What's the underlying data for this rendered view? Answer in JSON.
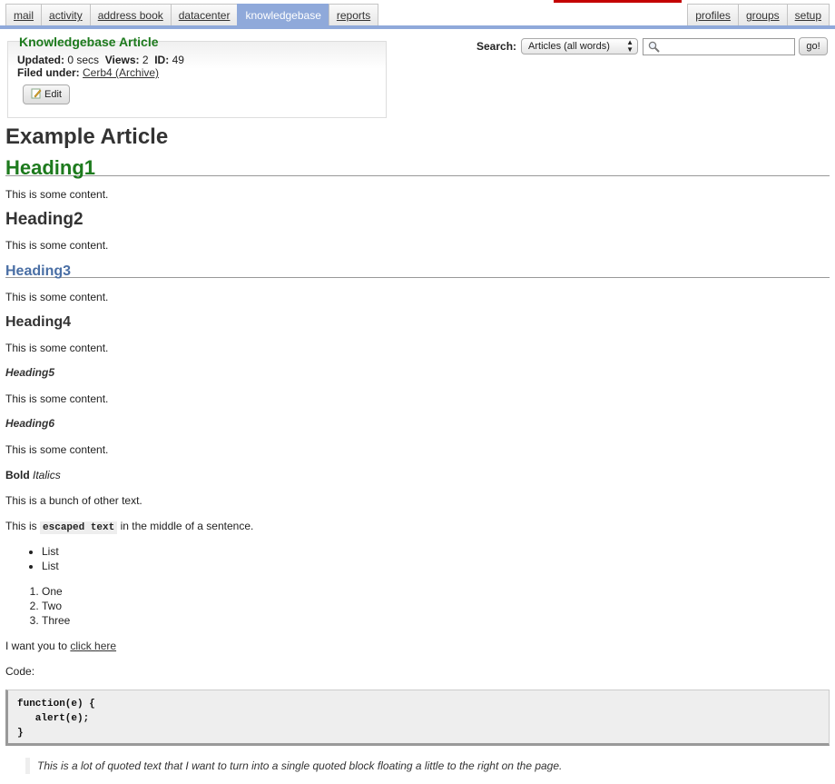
{
  "nav": {
    "left_tabs": [
      "mail",
      "activity",
      "address book",
      "datacenter",
      "knowledgebase",
      "reports"
    ],
    "active_tab": "knowledgebase",
    "right_tabs": [
      "profiles",
      "groups",
      "setup"
    ],
    "colors": {
      "nav_bar": "#8fa9da",
      "top_marker": "#c40000"
    }
  },
  "article_box": {
    "legend": "Knowledgebase Article",
    "updated_label": "Updated:",
    "updated_value": "0 secs",
    "views_label": "Views:",
    "views_value": "2",
    "id_label": "ID:",
    "id_value": "49",
    "filed_label": "Filed under:",
    "filed_value": "Cerb4 (Archive)",
    "edit_label": "Edit",
    "edit_icon": "edit-pencil-icon"
  },
  "search": {
    "label": "Search:",
    "scope": "Articles (all words)",
    "input_value": "",
    "go_label": "go!",
    "input_icon": "magnifier-icon"
  },
  "article": {
    "title": "Example Article",
    "h1": "Heading1",
    "h2": "Heading2",
    "h3": "Heading3",
    "h4": "Heading4",
    "h5": "Heading5",
    "h6": "Heading6",
    "content": "This is some content.",
    "bold": "Bold",
    "italics": "Italics",
    "other_text": "This is a bunch of other text.",
    "escaped_prefix": "This is ",
    "escaped_code": "escaped text",
    "escaped_suffix": " in the middle of a sentence.",
    "bullets": [
      "List",
      "List"
    ],
    "numbered": [
      "One",
      "Two",
      "Three"
    ],
    "link_prefix": "I want you to ",
    "link_text": "click here",
    "code_label": "Code:",
    "code_block": "function(e) {\n   alert(e);\n}",
    "quote": "This is a lot of quoted text that I want to turn into a single quoted block floating a little to the right on the page."
  }
}
